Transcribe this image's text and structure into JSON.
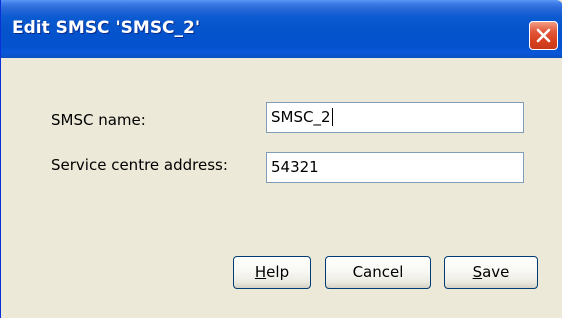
{
  "window": {
    "title": "Edit SMSC 'SMSC_2'"
  },
  "form": {
    "smsc_name_label": "SMSC name:",
    "smsc_name_value": "SMSC_2",
    "service_centre_address_label": "Service centre address:",
    "service_centre_address_value": "54321"
  },
  "buttons": {
    "help_mnemonic": "H",
    "help_rest": "elp",
    "cancel_label": "Cancel",
    "save_mnemonic": "S",
    "save_rest": "ave"
  },
  "icons": {
    "close": "close-icon"
  },
  "colors": {
    "titlebar": "#0453cc",
    "dialog_background": "#ece9d8",
    "close_button": "#d7401f",
    "input_border": "#7f9db9",
    "button_border": "#003c74"
  }
}
